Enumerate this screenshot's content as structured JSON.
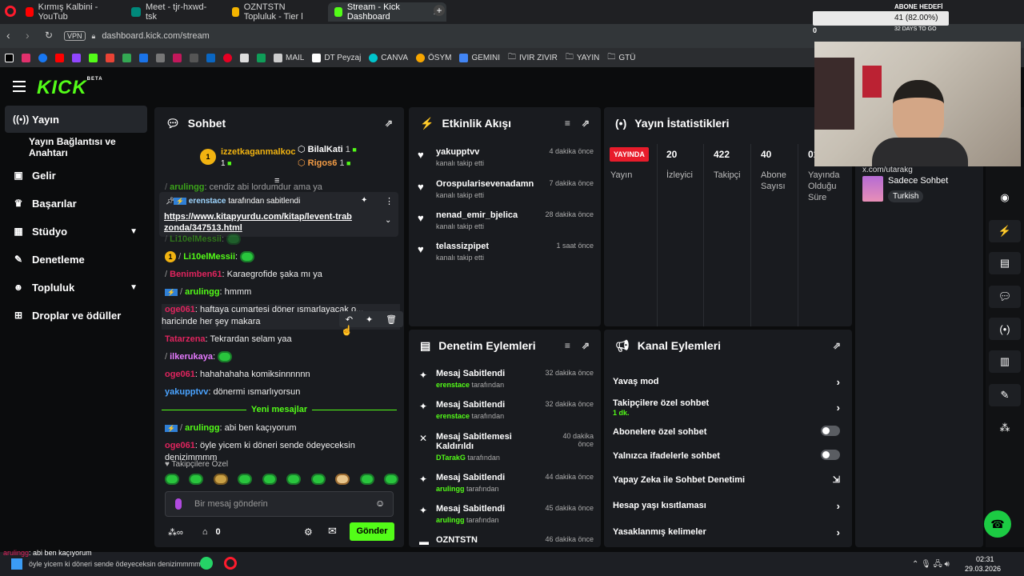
{
  "browser": {
    "tabs": [
      {
        "label": "Kırmış Kalbini - YouTub",
        "color": "#ff0000"
      },
      {
        "label": "Meet - tjr-hxwd-tsk",
        "color": "#00897b"
      },
      {
        "label": "OZNTSTN Topluluk - Tier l",
        "color": "#f4b400"
      },
      {
        "label": "Stream - Kick Dashboard",
        "color": "#53fc18"
      }
    ],
    "url": "dashboard.kick.com/stream",
    "vpn": "VPN",
    "bookmarks": [
      "MAIL",
      "DT Peyzaj",
      "CANVA",
      "ÖSYM",
      "GEMINI",
      "IVIR ZIVIR",
      "YAYIN",
      "GTÜ"
    ]
  },
  "overlay": {
    "goal_title": "ABONE HEDEFİ",
    "goal_value": "41 (82.00%)",
    "goal_sub": "32 DAYS TO GO",
    "zero": "0"
  },
  "brand": {
    "logo": "KICK",
    "beta": "BETA"
  },
  "sidebar": {
    "items": [
      {
        "label": "Yayın",
        "icon": "broadcast-icon"
      },
      {
        "label": "Yayın Bağlantısı ve Anahtarı",
        "icon": ""
      },
      {
        "label": "Gelir",
        "icon": "wallet-icon"
      },
      {
        "label": "Başarılar",
        "icon": "trophy-icon"
      },
      {
        "label": "Stüdyo",
        "icon": "grid-icon"
      },
      {
        "label": "Denetleme",
        "icon": "wrench-icon"
      },
      {
        "label": "Topluluk",
        "icon": "users-icon"
      },
      {
        "label": "Droplar ve ödüller",
        "icon": "gift-icon"
      }
    ]
  },
  "chat": {
    "title": "Sohbet",
    "top_gifters": [
      {
        "name": "izzetkaganmalkoc",
        "count": "1"
      },
      {
        "name": "BilalKati",
        "count": "1"
      },
      {
        "name": "Rigos6",
        "count": "1"
      }
    ],
    "pinned": {
      "by": "erenstace",
      "suffix": "tarafından sabitlendi",
      "link": "https://www.kitapyurdu.com/kitap/levent-trabzonda/347513.html"
    },
    "messages": [
      {
        "user": "arulingg",
        "text": "cendiz abi lordumdur ama ya",
        "color": "#53fc18"
      },
      {
        "user": "Li10elMessii",
        "text": "",
        "color": "#53fc18"
      },
      {
        "user": "Li10elMessii",
        "text": "",
        "color": "#53fc18"
      },
      {
        "user": "Benimben61",
        "text": "Karaegrofide şaka mı ya",
        "color": "#e0245e"
      },
      {
        "user": "arulingg",
        "text": "hmmm",
        "color": "#53fc18"
      },
      {
        "user": "oge061",
        "text": "haftaya cumartesi döner ısmarlayacak o... haricinde her şey makara",
        "color": "#e0245e"
      },
      {
        "user": "Tatarzena",
        "text": "Tekrardan selam yaa",
        "color": "#e0245e"
      },
      {
        "user": "ilkerukaya",
        "text": "",
        "color": "#e67aff"
      },
      {
        "user": "oge061",
        "text": "hahahahaha komiksinnnnnn",
        "color": "#e0245e"
      },
      {
        "user": "yakupptvv",
        "text": "dönermi ısmarlıyorsun",
        "color": "#4aa3ff"
      },
      {
        "user": "arulingg",
        "text": "abi ben kaçıyorum",
        "color": "#53fc18"
      },
      {
        "user": "oge061",
        "text": "öyle yicem ki döneri sende ödeyeceksin denizimmmm",
        "color": "#e0245e"
      }
    ],
    "new_messages": "Yeni mesajlar",
    "followers_only": "Takipçilere Özel",
    "input_placeholder": "Bir mesaj gönderin",
    "send": "Gönder",
    "points": "0"
  },
  "activity": {
    "title": "Etkinlik Akışı",
    "items": [
      {
        "name": "yakupptvv",
        "sub": "kanalı takip etti",
        "time": "4 dakika önce"
      },
      {
        "name": "Orospularisevenadamn",
        "sub": "kanalı takip etti",
        "time": "7 dakika önce"
      },
      {
        "name": "nenad_emir_bjelica",
        "sub": "kanalı takip etti",
        "time": "28 dakika önce"
      },
      {
        "name": "telassizpipet",
        "sub": "kanalı takip etti",
        "time": "1 saat önce"
      }
    ]
  },
  "stats": {
    "title": "Yayın İstatistikleri",
    "live_badge": "YAYINDA",
    "live_label": "Yayın",
    "items": [
      {
        "value": "20",
        "label": "İzleyici"
      },
      {
        "value": "422",
        "label": "Takipçi"
      },
      {
        "value": "40",
        "label": "Abone Sayısı"
      },
      {
        "value": "01",
        "label": "Yayında Olduğu Süre"
      }
    ]
  },
  "stream_info": {
    "mode": "Sadece Sohbet",
    "language": "Turkish",
    "handle": "x.com/utarakg"
  },
  "moderation": {
    "title": "Denetim Eylemleri",
    "items": [
      {
        "action": "Mesaj Sabitlendi",
        "user": "erenstace",
        "by": "tarafından",
        "time": "32 dakika önce"
      },
      {
        "action": "Mesaj Sabitlendi",
        "user": "erenstace",
        "by": "tarafından",
        "time": "32 dakika önce"
      },
      {
        "action": "Mesaj Sabitlemesi Kaldırıldı",
        "user": "DTarakG",
        "by": "tarafından",
        "time": "40 dakika önce"
      },
      {
        "action": "Mesaj Sabitlendi",
        "user": "arulingg",
        "by": "tarafından",
        "time": "44 dakika önce"
      },
      {
        "action": "Mesaj Sabitlendi",
        "user": "arulingg",
        "by": "tarafından",
        "time": "45 dakika önce"
      },
      {
        "action": "OZNTSTN",
        "user": "",
        "by": "",
        "time": "46 dakika önce"
      }
    ]
  },
  "channel": {
    "title": "Kanal Eylemleri",
    "items": [
      {
        "label": "Yavaş mod",
        "sub": "",
        "control": "arrow"
      },
      {
        "label": "Takipçilere özel sohbet",
        "sub": "1 dk.",
        "control": "arrow"
      },
      {
        "label": "Abonelere özel sohbet",
        "sub": "",
        "control": "toggle"
      },
      {
        "label": "Yalnızca ifadelerle sohbet",
        "sub": "",
        "control": "toggle"
      },
      {
        "label": "Yapay Zeka ile Sohbet Denetimi",
        "sub": "",
        "control": "external"
      },
      {
        "label": "Hesap yaşı kısıtlaması",
        "sub": "",
        "control": "arrow"
      },
      {
        "label": "Yasaklanmış kelimeler",
        "sub": "",
        "control": "arrow"
      }
    ]
  },
  "taskbar": {
    "time": "02:31",
    "date": "29.03.2026",
    "ticker_user": "arulingg",
    "ticker_text": "abi ben kaçıyorum",
    "ticker2": "öyle yicem ki döneri sende ödeyeceksin denizimmmm"
  },
  "colors": {
    "accent": "#53fc18",
    "panel": "#191b1f",
    "live": "#e81c2b"
  }
}
